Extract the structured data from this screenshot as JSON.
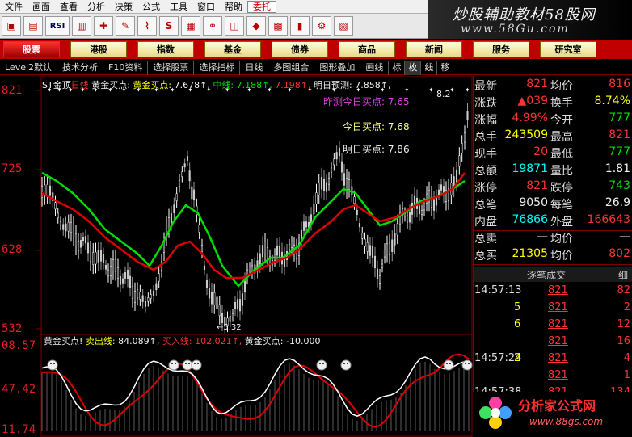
{
  "menu": [
    "文件",
    "画面",
    "查看",
    "分析",
    "决策",
    "公式",
    "工具",
    "窗口",
    "帮助",
    "委托"
  ],
  "banner": {
    "title": "炒股辅助教材58股网",
    "url": "www.58Gu.com"
  },
  "toolbar": {
    "rsi_label": "RSI",
    "s_label": "S"
  },
  "categories": [
    "股票",
    "港股",
    "指数",
    "基金",
    "债券",
    "商品",
    "新闻",
    "服务",
    "研究室"
  ],
  "tabs": [
    "Level2默认",
    "技术分析",
    "F10资料",
    "选择股票",
    "选择指标",
    "日线",
    "多图组合",
    "图形叠加",
    "画线",
    "标",
    "枚",
    "线",
    "移"
  ],
  "chart": {
    "stock_title": "ST金顶",
    "period": "日线",
    "legend_main": {
      "buy_label": "黄金买点:",
      "buy_value": "7.678",
      "mid_label": "中线:",
      "mid_value": "7.188",
      "ma_value": "7.198",
      "tomorrow_label": "明日预测:",
      "tomorrow_value": "7.858"
    },
    "right_price": "8.2",
    "annotations": {
      "yesterday": "昨测今日买点: 7.65",
      "today": "今日买点: 7.68",
      "tomorrow": "明日买点: 7.86"
    },
    "low_mark": "5.32",
    "y_labels_main": [
      "821",
      "725",
      "628",
      "532"
    ],
    "legend_sub": {
      "name": "黄金买点!",
      "sell_label": "卖出线:",
      "sell_value": "84.089",
      "buy_label": "买入线:",
      "buy_value": "102.021",
      "gold_label": "黄金买点:",
      "gold_value": "-10.000"
    },
    "y_labels_sub": [
      "08.57",
      "47.42",
      "11.74"
    ]
  },
  "quote": {
    "rows": [
      {
        "l1": "最新",
        "v1": "821",
        "c1": "red",
        "l2": "均价",
        "v2": "816",
        "c2": "red"
      },
      {
        "l1": "涨跌",
        "v1": "▲039",
        "c1": "red",
        "l2": "换手",
        "v2": "8.74%",
        "c2": "yellow"
      },
      {
        "l1": "涨幅",
        "v1": "4.99%",
        "c1": "red",
        "l2": "今开",
        "v2": "777",
        "c2": "green"
      },
      {
        "l1": "总手",
        "v1": "243509",
        "c1": "yellow",
        "l2": "最高",
        "v2": "821",
        "c2": "red"
      },
      {
        "l1": "现手",
        "v1": "20",
        "c1": "red",
        "l2": "最低",
        "v2": "777",
        "c2": "green"
      },
      {
        "l1": "总额",
        "v1": "19871",
        "c1": "cyan",
        "l2": "量比",
        "v2": "1.81",
        "c2": "white"
      },
      {
        "l1": "涨停",
        "v1": "821",
        "c1": "red",
        "l2": "跌停",
        "v2": "743",
        "c2": "green"
      },
      {
        "l1": "总笔",
        "v1": "9050",
        "c1": "white",
        "l2": "每笔",
        "v2": "26.9",
        "c2": "white"
      },
      {
        "l1": "内盘",
        "v1": "76866",
        "c1": "cyan",
        "l2": "外盘",
        "v2": "166643",
        "c2": "red"
      },
      {
        "l1": "总卖",
        "v1": "—",
        "c1": "white",
        "l2": "均价",
        "v2": "—",
        "c2": "white"
      },
      {
        "l1": "总买",
        "v1": "21305",
        "c1": "yellow",
        "l2": "均价",
        "v2": "802",
        "c2": "red"
      }
    ],
    "deals_title": "逐笔成交",
    "deals_tab": "细",
    "deals": [
      {
        "time": "14:57:13",
        "price": "821",
        "vol": "82",
        "vc": "red"
      },
      {
        "time": "",
        "price": "821",
        "vol": "2",
        "vc": "red"
      },
      {
        "time": "",
        "price": "821",
        "vol": "12",
        "vc": "red"
      },
      {
        "time": "",
        "price": "821",
        "vol": "16",
        "vc": "red"
      },
      {
        "time": "14:57:24",
        "price": "821",
        "vol": "4",
        "vc": "red"
      },
      {
        "time": "",
        "price": "821",
        "vol": "1",
        "vc": "red"
      },
      {
        "time": "14:57:38",
        "price": "821",
        "vol": "134",
        "vc": "red"
      }
    ],
    "deal_left_vols": [
      "",
      "5",
      "6",
      "",
      "2",
      ""
    ]
  },
  "fxj": {
    "title": "分析家公式网",
    "url": "www.88gs.com"
  },
  "colors": {
    "up": "#ff3232",
    "down": "#00e000",
    "ma_green": "#00dd00",
    "ma_red": "#dd0000",
    "kdj_white": "#ffffff",
    "kdj_red": "#dd0000"
  }
}
